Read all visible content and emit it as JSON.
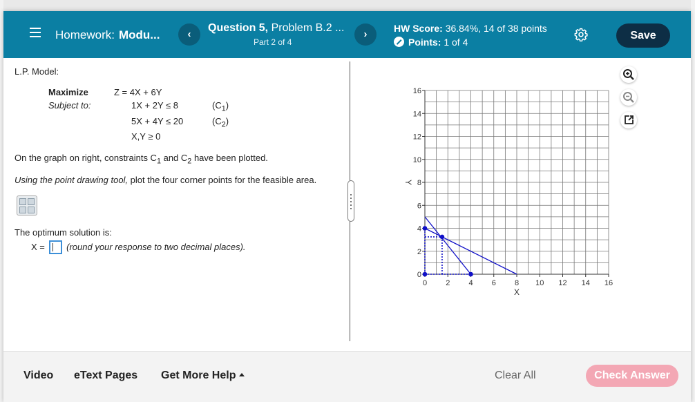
{
  "header": {
    "hw_prefix": "Homework:",
    "hw_module": "Modu...",
    "question_label": "Question 5,",
    "problem_label": "Problem B.2 ...",
    "part_label": "Part 2 of 4",
    "score_label": "HW Score:",
    "score_value": "36.84%, 14 of 38 points",
    "points_label": "Points:",
    "points_value": "1 of 4",
    "save_label": "Save",
    "prev_glyph": "‹",
    "next_glyph": "›"
  },
  "problem": {
    "model_label": "L.P. Model:",
    "maximize_label": "Maximize",
    "subject_label": "Subject to:",
    "objective": "Z = 4X + 6Y",
    "constraint1": "1X + 2Y ≤ 8",
    "constraint1_tag_pre": "(C",
    "constraint1_sub": "1",
    "constraint1_tag_post": ")",
    "constraint2": "5X + 4Y ≤ 20",
    "constraint2_tag_pre": "(C",
    "constraint2_sub": "2",
    "constraint2_tag_post": ")",
    "nonneg": "X,Y ≥ 0",
    "instr1_a": "On the graph on right, constraints C",
    "instr1_sub1": "1",
    "instr1_b": " and C",
    "instr1_sub2": "2",
    "instr1_c": " have been plotted.",
    "instr2_italic": "Using the point drawing tool,",
    "instr2_rest": " plot the four corner points for the feasible area.",
    "optimum_label": "The optimum solution is:",
    "x_label": "X =",
    "round_note": "(round your response to two decimal places)."
  },
  "chart_data": {
    "type": "scatter",
    "xlabel": "X",
    "ylabel": "Y",
    "xlim": [
      0,
      16
    ],
    "ylim": [
      0,
      16
    ],
    "xticks": [
      0,
      2,
      4,
      6,
      8,
      10,
      12,
      14,
      16
    ],
    "yticks": [
      0,
      2,
      4,
      6,
      8,
      10,
      12,
      14,
      16
    ],
    "grid": true,
    "lines": [
      {
        "name": "C1",
        "points": [
          [
            0,
            4
          ],
          [
            8,
            0
          ]
        ]
      },
      {
        "name": "C2",
        "points": [
          [
            0,
            5
          ],
          [
            4,
            0
          ]
        ]
      }
    ],
    "points": [
      [
        0,
        0
      ],
      [
        0,
        4
      ],
      [
        1.5,
        3.25
      ],
      [
        4,
        0
      ]
    ],
    "guide_lines": [
      {
        "points": [
          [
            0,
            3.25
          ],
          [
            1.5,
            3.25
          ]
        ]
      },
      {
        "points": [
          [
            1.5,
            0
          ],
          [
            1.5,
            3.25
          ]
        ]
      }
    ]
  },
  "footer": {
    "video": "Video",
    "etext": "eText Pages",
    "help": "Get More Help",
    "clear_all": "Clear All",
    "check_answer": "Check Answer"
  }
}
